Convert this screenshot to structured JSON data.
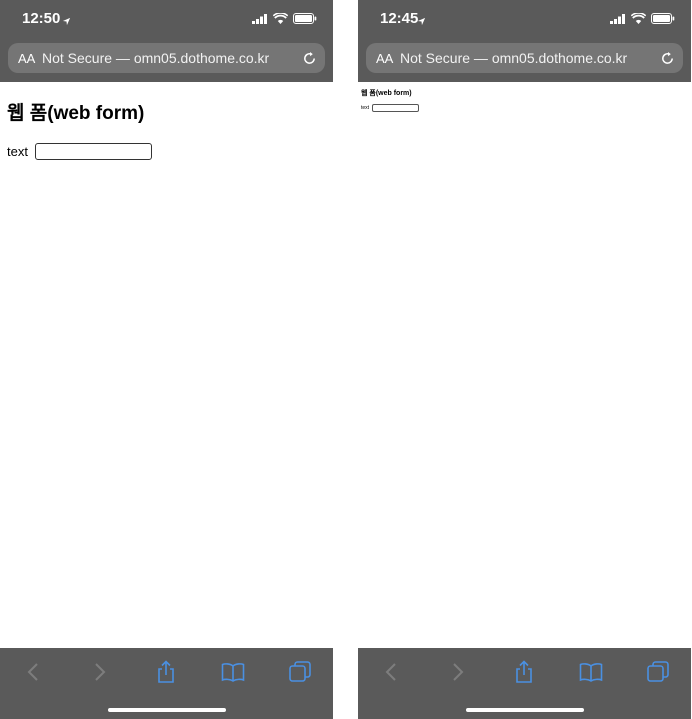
{
  "left": {
    "status": {
      "time": "12:50"
    },
    "address": {
      "reader_label": "AA",
      "url": "Not Secure — ‌omn05.dothome.co.kr"
    },
    "page": {
      "heading": "웹 폼(web form)",
      "text_label": "text",
      "text_value": ""
    }
  },
  "right": {
    "status": {
      "time": "12:45"
    },
    "address": {
      "reader_label": "AA",
      "url": "Not Secure — ‌omn05.dothome.co.kr"
    },
    "page": {
      "heading": "웹 폼(web form)",
      "text_label": "text",
      "text_value": ""
    }
  },
  "colors": {
    "chrome_bg": "#5a5a5a",
    "url_field_bg": "#757575",
    "toolbar_icon": "#4a90e2",
    "toolbar_disabled": "#7d7d7d"
  },
  "icons": [
    "location-arrow-icon",
    "signal-icon",
    "wifi-icon",
    "battery-icon",
    "reload-icon",
    "back-icon",
    "forward-icon",
    "share-icon",
    "bookmarks-icon",
    "tabs-icon"
  ]
}
